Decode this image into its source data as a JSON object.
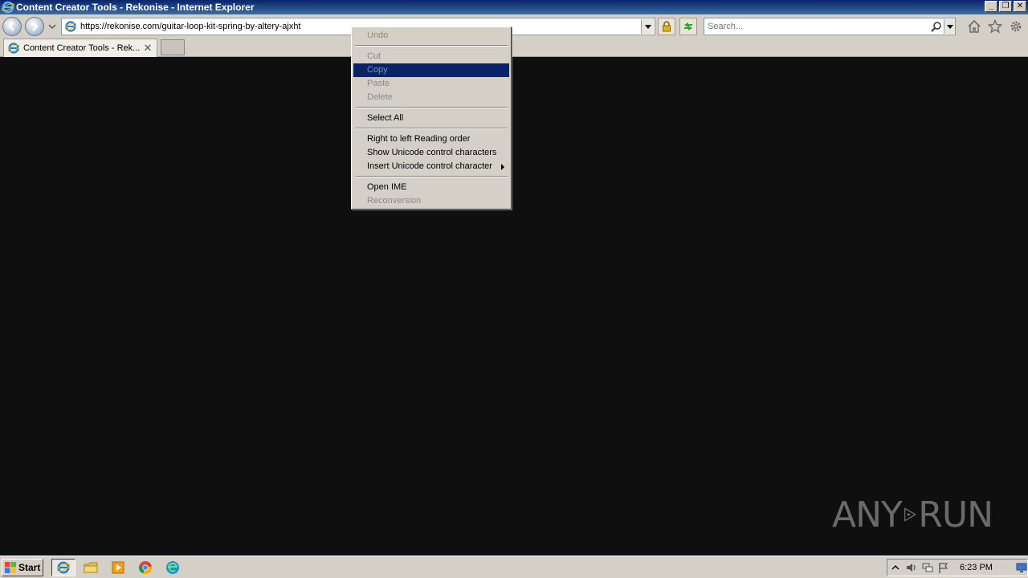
{
  "window": {
    "title": "Content Creator Tools - Rekonise - Internet Explorer",
    "controls": {
      "minimize": "_",
      "restore": "❐",
      "close": "✕"
    }
  },
  "navbar": {
    "url": "https://rekonise.com/guitar-loop-kit-spring-by-altery-ajxht",
    "search_placeholder": "Search..."
  },
  "tabs": [
    {
      "label": "Content Creator Tools - Rek...",
      "close": "✕"
    }
  ],
  "context_menu": {
    "items": [
      {
        "label": "Undo",
        "disabled": true
      },
      {
        "label": "Cut",
        "disabled": true
      },
      {
        "label": "Copy",
        "disabled": true,
        "selected": true
      },
      {
        "label": "Paste",
        "disabled": true
      },
      {
        "label": "Delete",
        "disabled": true
      },
      {
        "label": "Select All",
        "disabled": false
      },
      {
        "label": "Right to left Reading order",
        "disabled": false
      },
      {
        "label": "Show Unicode control characters",
        "disabled": false
      },
      {
        "label": "Insert Unicode control character",
        "disabled": false,
        "submenu": true
      },
      {
        "label": "Open IME",
        "disabled": false
      },
      {
        "label": "Reconversion",
        "disabled": true
      }
    ]
  },
  "watermark": {
    "left": "ANY",
    "right": "RUN"
  },
  "taskbar": {
    "start_label": "Start",
    "clock": "6:23 PM"
  },
  "colors": {
    "menu_highlight": "#0a246a",
    "page_background": "#0f0f0f",
    "chrome": "#d4d0c8"
  }
}
